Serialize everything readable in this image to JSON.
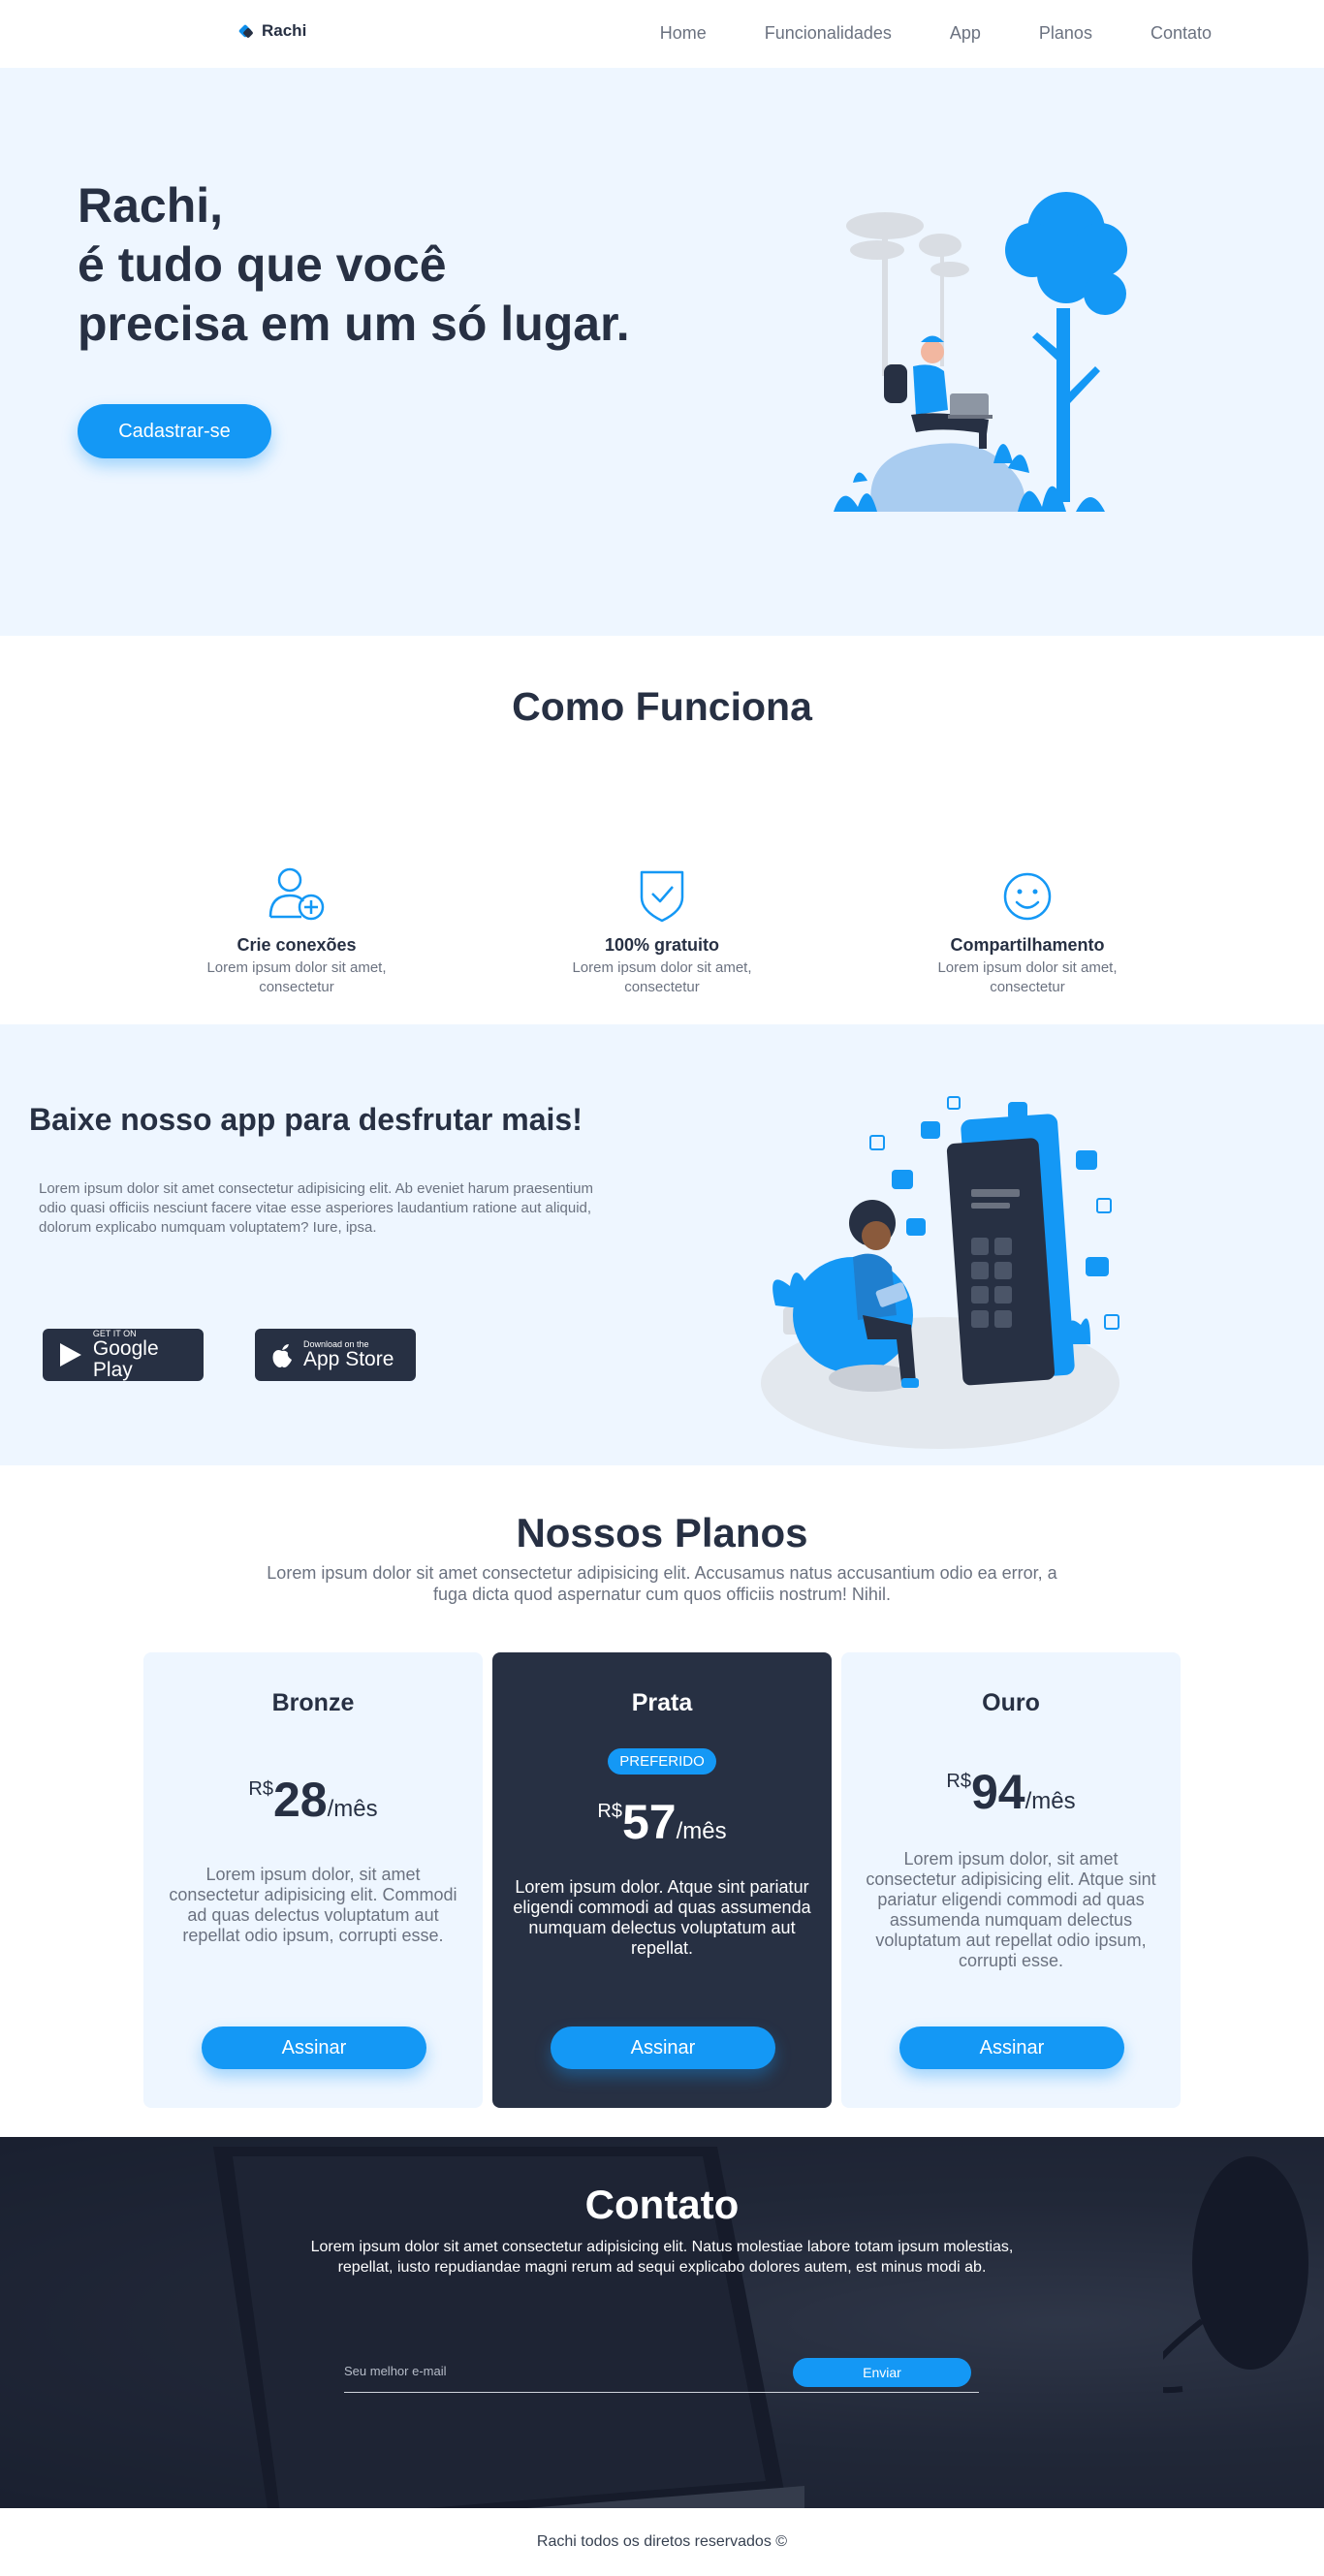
{
  "header": {
    "logo_text": "Rachi",
    "nav": [
      "Home",
      "Funcionalidades",
      "App",
      "Planos",
      "Contato"
    ]
  },
  "hero": {
    "title_line1": "Rachi,",
    "title_line2": "é tudo que você",
    "title_line3": "precisa em um só lugar.",
    "cta_label": "Cadastrar-se"
  },
  "how": {
    "title": "Como Funciona",
    "features": [
      {
        "icon": "add-user-icon",
        "title": "Crie conexões",
        "text": "Lorem ipsum dolor sit amet, consectetur"
      },
      {
        "icon": "shield-check-icon",
        "title": "100% gratuito",
        "text": "Lorem ipsum dolor sit amet, consectetur"
      },
      {
        "icon": "smile-icon",
        "title": "Compartilhamento",
        "text": "Lorem ipsum dolor sit amet, consectetur"
      }
    ]
  },
  "app": {
    "title": "Baixe nosso app para desfrutar mais!",
    "text": "Lorem ipsum dolor sit amet consectetur adipisicing elit. Ab eveniet harum praesentium odio quasi officiis nesciunt facere vitae esse asperiores laudantium ratione aut aliquid, dolorum explicabo numquam voluptatem? Iure, ipsa.",
    "google_small": "GET IT ON",
    "google_big": "Google Play",
    "apple_small": "Download on the",
    "apple_big": "App Store"
  },
  "plans": {
    "title": "Nossos Planos",
    "subtitle": "Lorem ipsum dolor sit amet consectetur adipisicing elit. Accusamus natus accusantium odio ea error, a fuga dicta quod aspernatur cum quos officiis nostrum! Nihil.",
    "currency": "R$",
    "period": "/mês",
    "items": [
      {
        "name": "Bronze",
        "price": "28",
        "desc": "Lorem ipsum dolor, sit amet consectetur adipisicing elit. Commodi ad quas delectus voluptatum aut repellat odio ipsum, corrupti esse.",
        "button": "Assinar"
      },
      {
        "name": "Prata",
        "badge": "PREFERIDO",
        "price": "57",
        "desc": "Lorem ipsum dolor. Atque sint pariatur eligendi commodi ad quas assumenda numquam delectus voluptatum aut repellat.",
        "button": "Assinar"
      },
      {
        "name": "Ouro",
        "price": "94",
        "desc": "Lorem ipsum dolor, sit amet consectetur adipisicing elit. Atque sint pariatur eligendi commodi ad quas assumenda numquam delectus voluptatum aut repellat odio ipsum, corrupti esse.",
        "button": "Assinar"
      }
    ]
  },
  "contact": {
    "title": "Contato",
    "text": "Lorem ipsum dolor sit amet consectetur adipisicing elit. Natus molestiae labore totam ipsum molestias, repellat, iusto repudiandae magni rerum ad sequi explicabo dolores autem, est minus modi ab.",
    "email_placeholder": "Seu melhor e-mail",
    "send_label": "Enviar"
  },
  "footer": {
    "text": "Rachi todos os diretos reservados ©"
  },
  "colors": {
    "accent": "#1498f5",
    "dark": "#273043",
    "light_bg": "#eef6ff",
    "muted_text": "#6b7280"
  }
}
